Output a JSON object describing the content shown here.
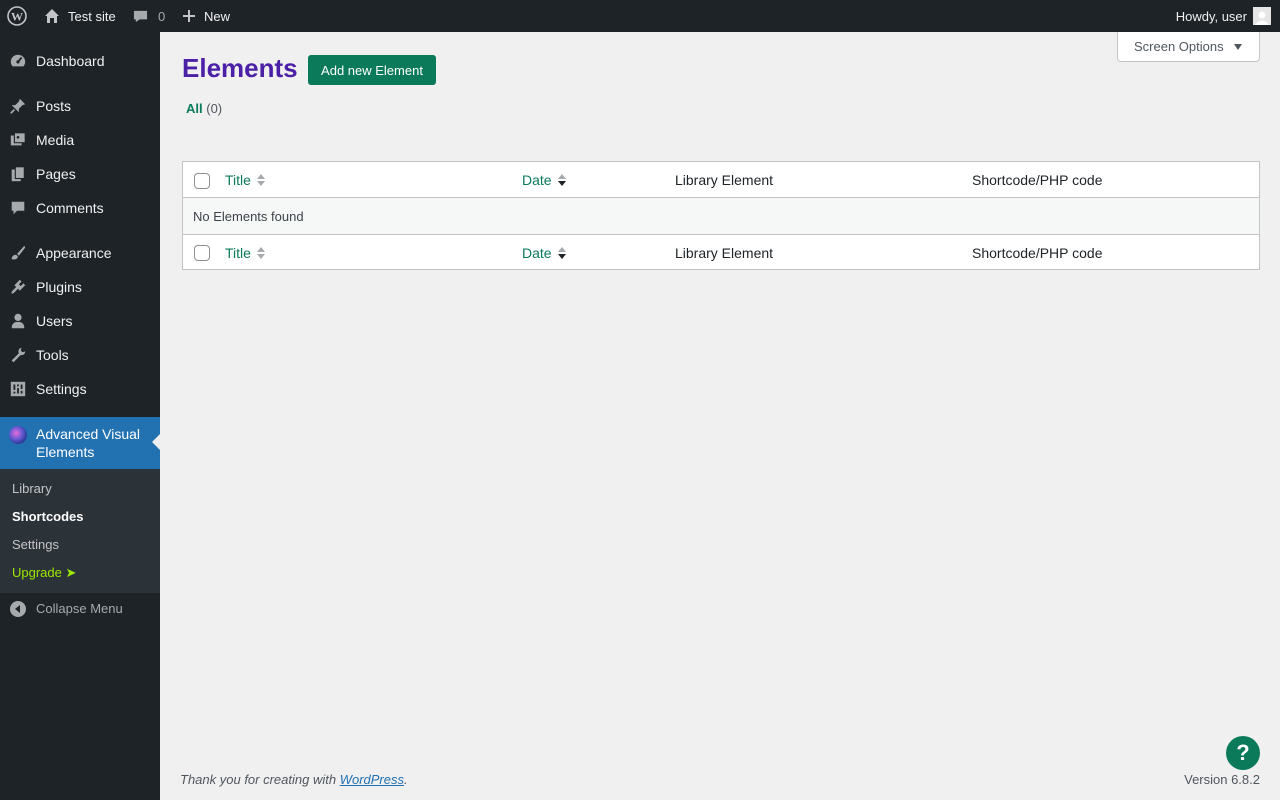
{
  "adminbar": {
    "site_name": "Test site",
    "comments_count": "0",
    "new_label": "New",
    "greeting": "Howdy, user"
  },
  "sidebar": {
    "items": [
      {
        "label": "Dashboard",
        "icon": "dashboard-icon"
      },
      {
        "label": "Posts",
        "icon": "pin-icon"
      },
      {
        "label": "Media",
        "icon": "media-icon"
      },
      {
        "label": "Pages",
        "icon": "pages-icon"
      },
      {
        "label": "Comments",
        "icon": "comment-icon"
      },
      {
        "label": "Appearance",
        "icon": "brush-icon"
      },
      {
        "label": "Plugins",
        "icon": "plugin-icon"
      },
      {
        "label": "Users",
        "icon": "user-icon"
      },
      {
        "label": "Tools",
        "icon": "wrench-icon"
      },
      {
        "label": "Settings",
        "icon": "settings-icon"
      }
    ],
    "active": {
      "label": "Advanced Visual Elements",
      "icon": "ave-logo-icon"
    },
    "submenu": [
      {
        "label": "Library"
      },
      {
        "label": "Shortcodes"
      },
      {
        "label": "Settings"
      },
      {
        "label": "Upgrade ➤"
      }
    ],
    "collapse_label": "Collapse Menu"
  },
  "main": {
    "screen_options": "Screen Options",
    "title": "Elements",
    "add_new": "Add new Element",
    "filter_all": "All",
    "filter_count": "(0)",
    "columns": [
      "Title",
      "Date",
      "Library Element",
      "Shortcode/PHP code"
    ],
    "empty_message": "No Elements found"
  },
  "footer": {
    "thanks_prefix": "Thank you for creating with ",
    "wordpress_link": "WordPress",
    "thanks_suffix": ".",
    "version": "Version 6.8.2"
  },
  "help_button": "?",
  "colors": {
    "admin_dark": "#1d2327",
    "accent_blue": "#2271b1",
    "green_button": "#0a7a5a",
    "title_purple": "#4b1fa6",
    "upgrade_green": "#9be600"
  }
}
